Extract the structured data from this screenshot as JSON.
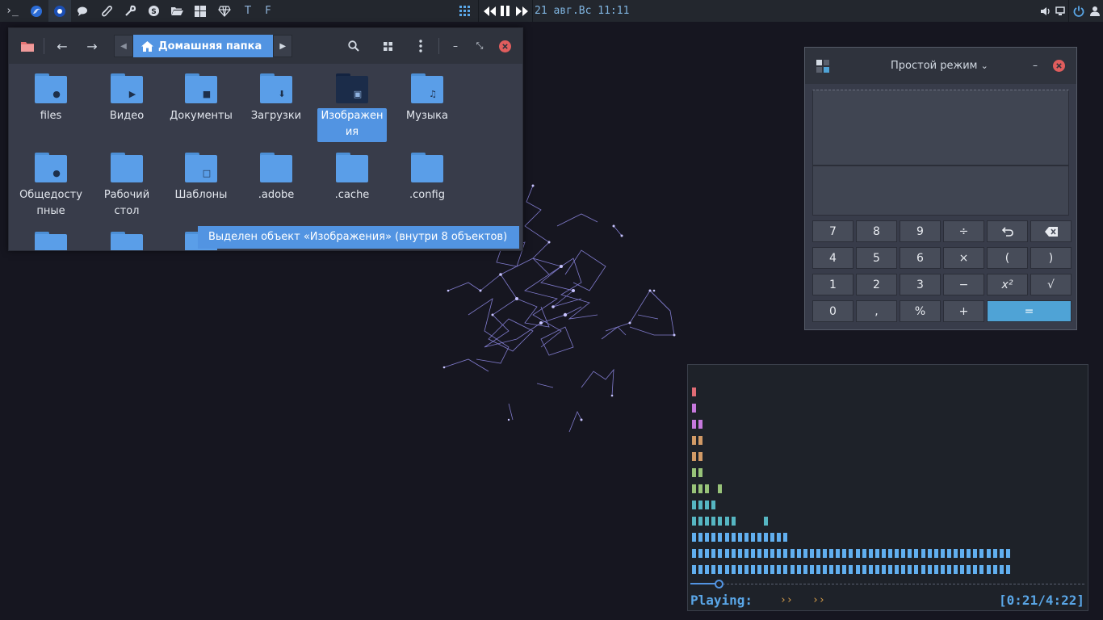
{
  "taskbar": {
    "terminal_label": "›_",
    "t_label": "T",
    "f_label": "F",
    "datetime": "21 авг.Вс 11:11"
  },
  "file_manager": {
    "breadcrumb": "Домашняя папка",
    "items": [
      {
        "label": "files",
        "glyph": "●"
      },
      {
        "label": "Видео",
        "glyph": "▶"
      },
      {
        "label": "Документы",
        "glyph": "■"
      },
      {
        "label": "Загрузки",
        "glyph": "⬇"
      },
      {
        "label": "Изображения",
        "glyph": "▣"
      },
      {
        "label": "Музыка",
        "glyph": "♫"
      },
      {
        "label": "Общедоступные",
        "glyph": "●"
      },
      {
        "label": "Рабочий стол",
        "glyph": ""
      },
      {
        "label": "Шаблоны",
        "glyph": "□"
      },
      {
        "label": ".adobe",
        "glyph": ""
      },
      {
        "label": ".cache",
        "glyph": ""
      },
      {
        "label": ".config",
        "glyph": ""
      }
    ],
    "status": "Выделен объект «Изображения» (внутри 8 объектов)"
  },
  "calculator": {
    "mode": "Простой режим",
    "keys": [
      "7",
      "8",
      "9",
      "÷",
      "↶",
      "⌫",
      "4",
      "5",
      "6",
      "×",
      "(",
      ")",
      "1",
      "2",
      "3",
      "−",
      "x²",
      "√",
      "0",
      ",",
      "%",
      "+",
      "="
    ]
  },
  "player": {
    "state": "Playing:",
    "arrows1": "››",
    "arrows2": "››",
    "time": "[0:21/4:22]",
    "rows": [
      1,
      1,
      2,
      2,
      2,
      2,
      4,
      4,
      8,
      15,
      49,
      49
    ],
    "row_colors": [
      "#e06c75",
      "#c678dd",
      "#c678dd",
      "#d19a66",
      "#d19a66",
      "#98c379",
      "#98c379",
      "#56b6c2",
      "#56b6c2",
      "#61afef",
      "#61afef",
      "#61afef"
    ],
    "progress": 0.08
  }
}
